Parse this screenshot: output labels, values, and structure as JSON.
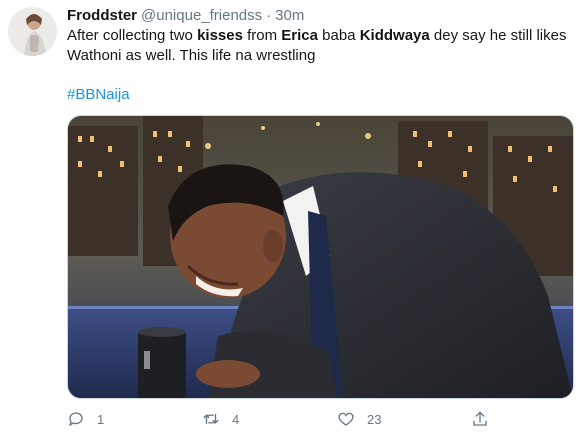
{
  "tweet": {
    "display_name": "Froddster",
    "handle": "@unique_friendss",
    "separator": "·",
    "time": "30m",
    "text": {
      "t1": "After collecting two ",
      "t2": "kisses",
      "t3": " from ",
      "t4": "Erica",
      "t5": " baba ",
      "t6": "Kiddwaya",
      "t7": " dey say he still likes Wathoni as well. This life na wrestling"
    },
    "hashtag": "#BBNaija",
    "media_description": "Photo of a man in a suit laughing, head down over a desk with a mug",
    "actions": {
      "reply_icon": "reply-icon",
      "reply_count": "1",
      "retweet_icon": "retweet-icon",
      "retweet_count": "4",
      "like_icon": "heart-icon",
      "like_count": "23",
      "share_icon": "share-icon"
    }
  },
  "colors": {
    "text": "#14171a",
    "secondary": "#657786",
    "link": "#1b95e0",
    "border": "#ccd6dd"
  }
}
